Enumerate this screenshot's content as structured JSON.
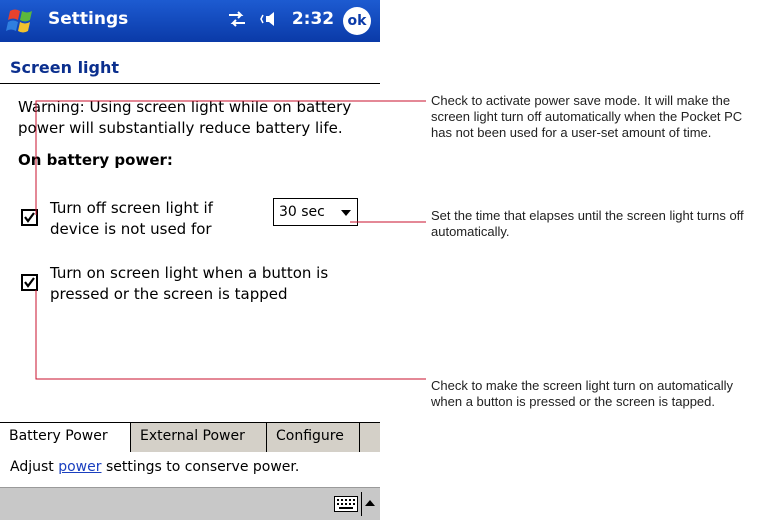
{
  "titlebar": {
    "app_title": "Settings",
    "clock": "2:32",
    "ok_label": "ok",
    "color": "#0a3aa8"
  },
  "page": {
    "title": "Screen light",
    "warning": "Warning: Using screen light while on battery power will substantially reduce battery life.",
    "section_heading": "On battery power:",
    "option1": {
      "label": "Turn off screen light if device is not used for",
      "checked": true
    },
    "timeout": {
      "value": "30 sec"
    },
    "option2": {
      "label": "Turn on screen light when a button is pressed or the screen is tapped",
      "checked": true
    }
  },
  "tabs": [
    {
      "label": "Battery Power",
      "active": true
    },
    {
      "label": "External Power",
      "active": false
    },
    {
      "label": "Configure",
      "active": false
    }
  ],
  "help": {
    "prefix": "Adjust ",
    "link": "power",
    "suffix": " settings to conserve power."
  },
  "callouts": [
    "Check to activate power save mode. It will make the screen light turn off automatically when the Pocket PC has not been used for a user-set amount of time.",
    "Set the time that elapses until the screen light turns off automatically.",
    "Check to make the screen light turn on automatically when a button is pressed or the screen is tapped."
  ],
  "icons": {
    "start": "windows-flag-icon",
    "sync": "sync-icon",
    "volume": "speaker-icon",
    "keyboard": "keyboard-icon",
    "sip": "up-arrow-icon"
  }
}
